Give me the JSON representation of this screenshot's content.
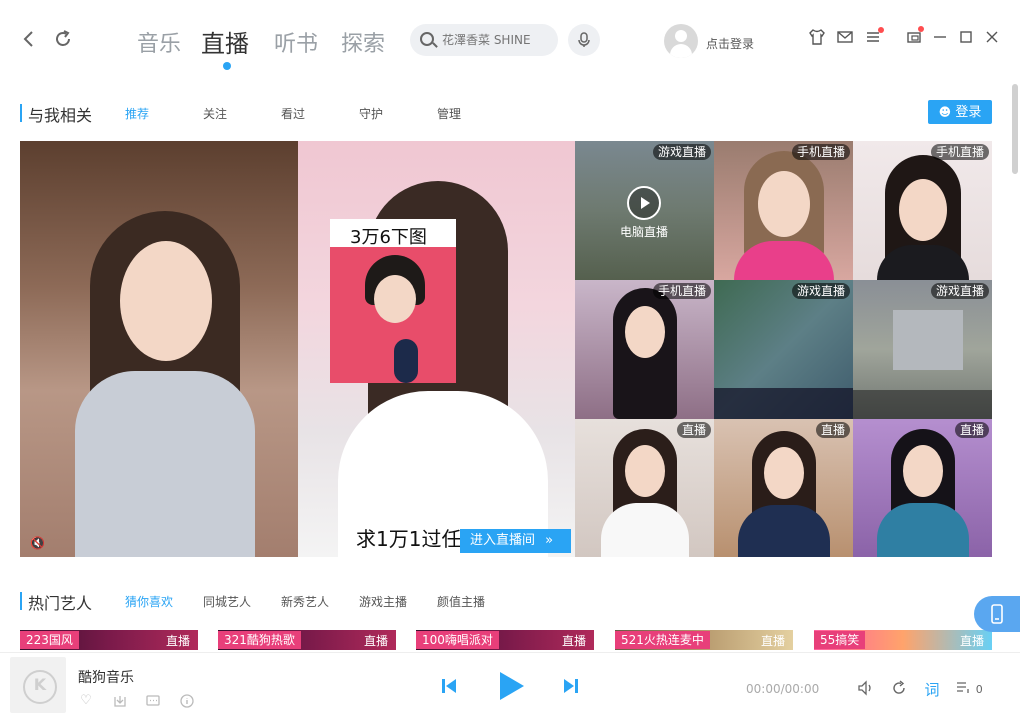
{
  "header": {
    "back_icon": "chevron-left-icon",
    "refresh_icon": "refresh-icon",
    "tabs": [
      {
        "label": "音乐",
        "active": false
      },
      {
        "label": "直播",
        "active": true
      },
      {
        "label": "听书",
        "active": false
      },
      {
        "label": "探索",
        "active": false
      }
    ],
    "search_placeholder": "花澤香菜 SHINE",
    "login_text": "点击登录",
    "accent_color": "#2aa4f4"
  },
  "related": {
    "title": "与我相关",
    "tabs": [
      "推荐",
      "关注",
      "看过",
      "守护",
      "管理"
    ],
    "login_button": "登录"
  },
  "live": {
    "featured_caption_top": "3万6下图",
    "featured_caption_bottom": "求1万1过任务",
    "enter_button": "进入直播间",
    "pc_live_label": "电脑直播",
    "grid": [
      {
        "badge": "游戏直播"
      },
      {
        "badge": "手机直播"
      },
      {
        "badge": "手机直播"
      },
      {
        "badge": "手机直播"
      },
      {
        "badge": "游戏直播"
      },
      {
        "badge": "游戏直播"
      },
      {
        "badge": "直播"
      },
      {
        "badge": "直播"
      },
      {
        "badge": "直播"
      }
    ]
  },
  "hot_artists": {
    "title": "热门艺人",
    "tabs": [
      "猜你喜欢",
      "同城艺人",
      "新秀艺人",
      "游戏主播",
      "颜值主播"
    ],
    "cards": [
      {
        "name": "223国风",
        "badge": "直播"
      },
      {
        "name": "321酷狗热歌",
        "badge": "直播"
      },
      {
        "name": "100嗨唱派对",
        "badge": "直播"
      },
      {
        "name": "521火热连麦中",
        "badge": "直播"
      },
      {
        "name": "55搞笑",
        "badge": "直播"
      }
    ]
  },
  "player": {
    "song_title": "酷狗音乐",
    "time": "00:00/00:00",
    "lyrics_label": "词",
    "playlist_count": "0"
  }
}
